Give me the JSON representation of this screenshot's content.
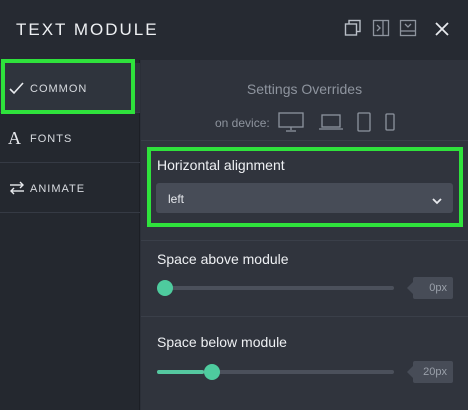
{
  "header": {
    "title": "TEXT MODULE",
    "icons": [
      "copy-icon",
      "expand-sidebar-icon",
      "minimize-icon",
      "close-icon"
    ]
  },
  "sidebar": {
    "items": [
      {
        "label": "COMMON",
        "icon": "checkmark-icon",
        "active": true
      },
      {
        "label": "FONTS",
        "icon": "font-a-icon",
        "active": false
      },
      {
        "label": "ANIMATE",
        "icon": "swap-arrows-icon",
        "active": false
      }
    ]
  },
  "main": {
    "overrides_title": "Settings Overrides",
    "device_label": "on device:",
    "devices": [
      "desktop-icon",
      "laptop-icon",
      "tablet-icon",
      "phone-icon"
    ],
    "alignment": {
      "label": "Horizontal alignment",
      "value": "left"
    },
    "space_above": {
      "label": "Space above module",
      "value": "0px",
      "level": 0.0
    },
    "space_below": {
      "label": "Space below module",
      "value": "20px",
      "level": 0.2
    }
  },
  "colors": {
    "highlight": "#2fe23c",
    "slider_accent": "#4ecb9e"
  }
}
